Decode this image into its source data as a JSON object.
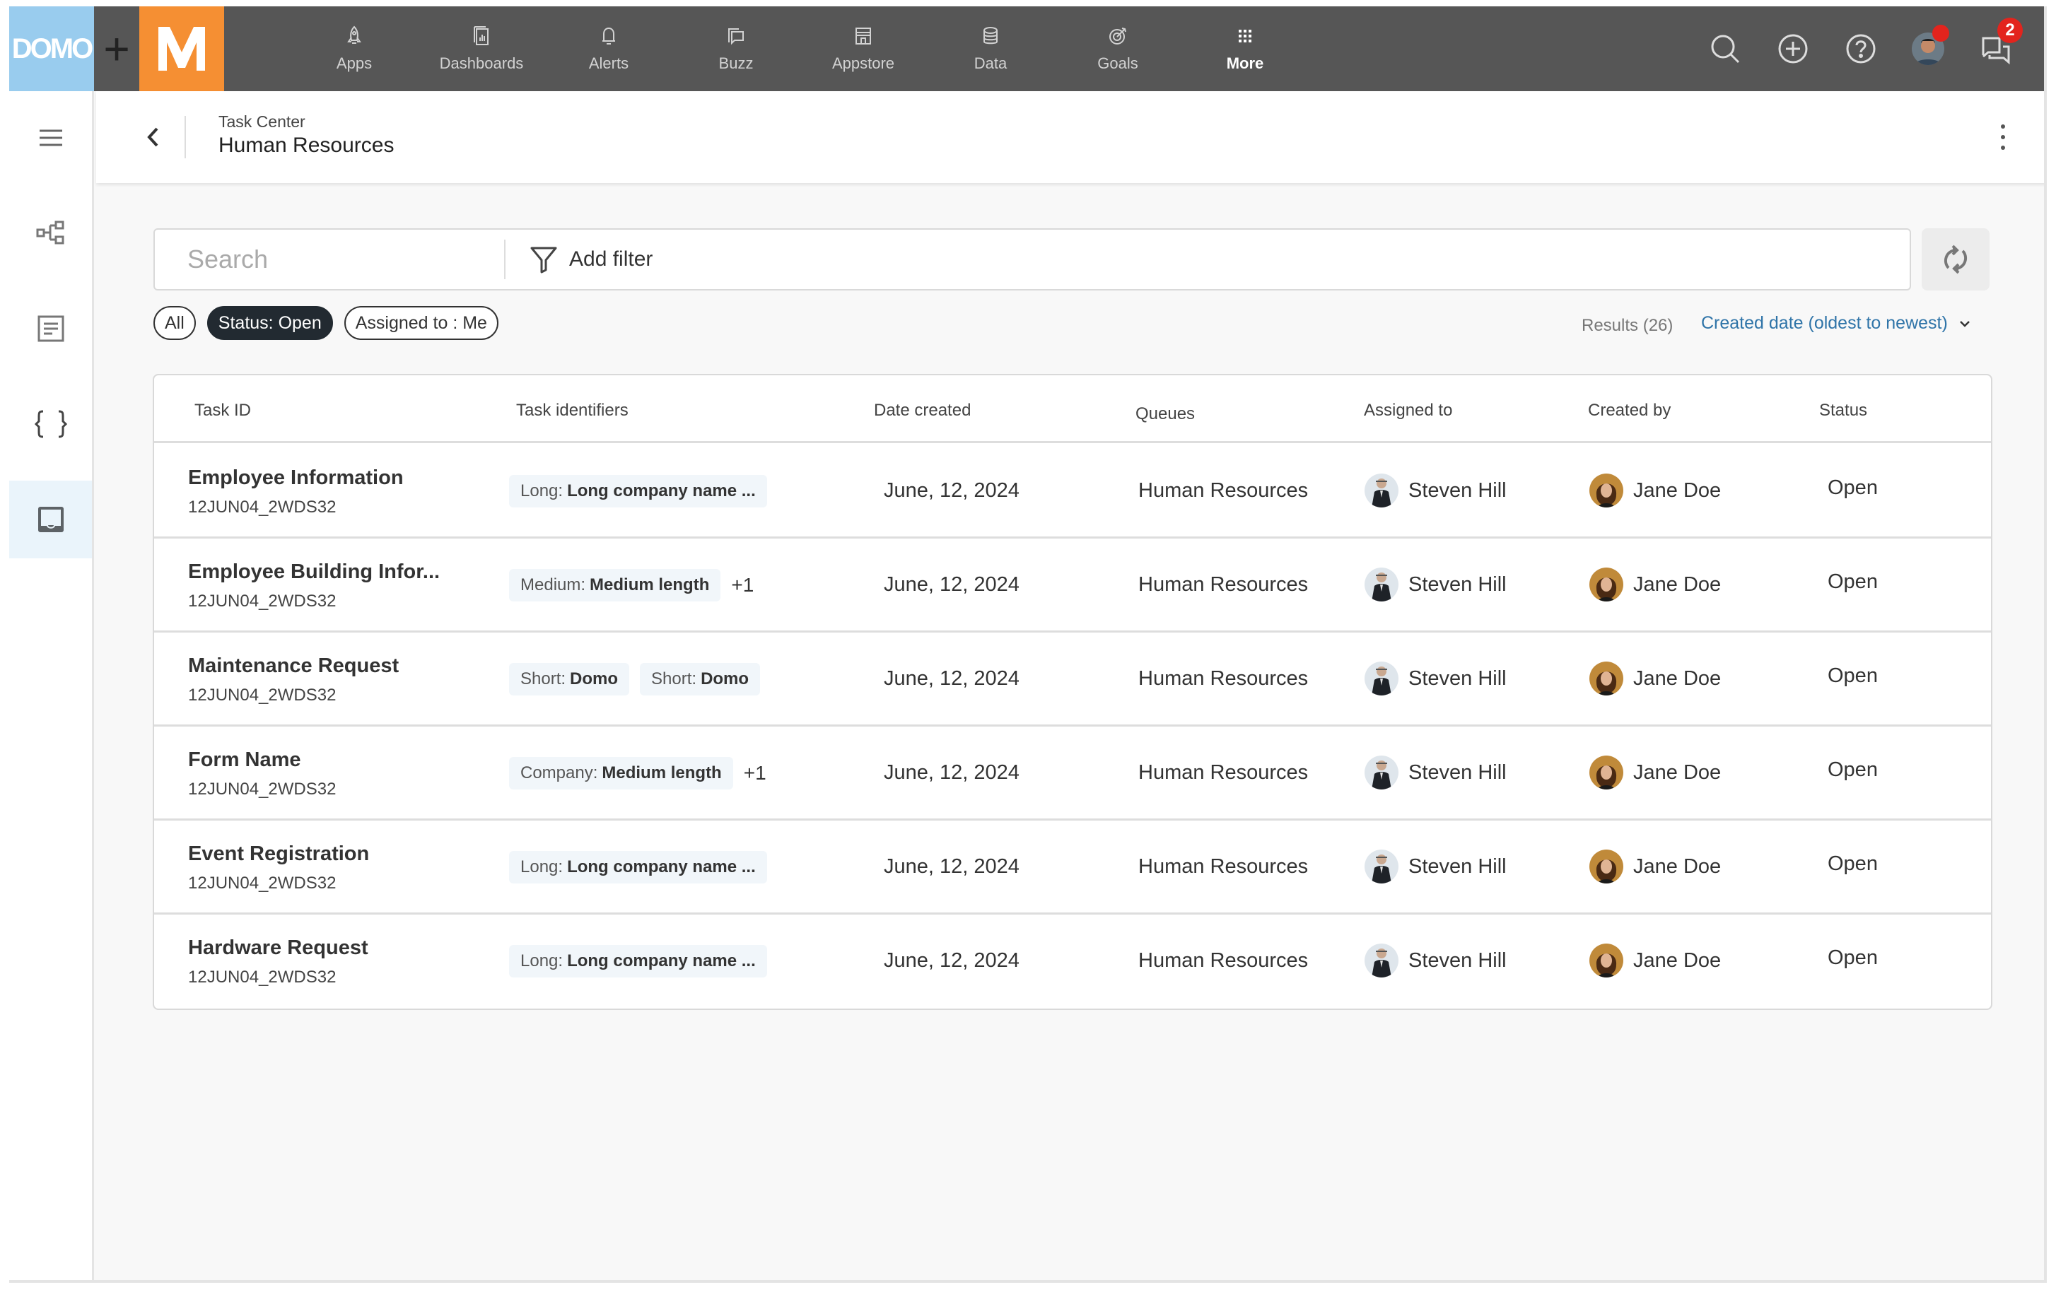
{
  "branding": {
    "domo_logo": "DOMO",
    "plus": "+",
    "m_logo": "M"
  },
  "topnav": {
    "items": [
      {
        "label": "Apps",
        "icon": "rocket-icon"
      },
      {
        "label": "Dashboards",
        "icon": "dashboard-icon"
      },
      {
        "label": "Alerts",
        "icon": "bell-icon"
      },
      {
        "label": "Buzz",
        "icon": "chat-icon"
      },
      {
        "label": "Appstore",
        "icon": "store-icon"
      },
      {
        "label": "Data",
        "icon": "database-icon"
      },
      {
        "label": "Goals",
        "icon": "target-icon"
      },
      {
        "label": "More",
        "icon": "grid-icon",
        "active": true
      }
    ],
    "notifications_count": "2",
    "colors": {
      "bar": "#565656",
      "domo": "#99ccee",
      "m": "#f58f33",
      "badge": "#e3241d"
    }
  },
  "sidebar": {
    "items": [
      {
        "name": "menu",
        "icon": "hamburger-menu-icon"
      },
      {
        "name": "workflows",
        "icon": "workflow-icon"
      },
      {
        "name": "forms",
        "icon": "document-icon"
      },
      {
        "name": "code",
        "icon": "braces-icon"
      },
      {
        "name": "task-center",
        "icon": "inbox-icon",
        "active": true
      }
    ]
  },
  "header": {
    "breadcrumb": "Task Center",
    "title": "Human Resources"
  },
  "search": {
    "placeholder": "Search",
    "value": "",
    "add_filter_label": "Add filter"
  },
  "filters": {
    "chips": [
      {
        "label": "All",
        "active": false
      },
      {
        "label": "Status: Open",
        "active": true
      },
      {
        "label": "Assigned to : Me",
        "active": false
      }
    ],
    "results": "Results (26)",
    "sort_label": "Created date (oldest to newest)"
  },
  "table": {
    "columns": [
      "Task ID",
      "Task identifiers",
      "Date created",
      "Queues",
      "Assigned to",
      "Created by",
      "Status"
    ],
    "rows": [
      {
        "name": "Employee Information",
        "id": "12JUN04_2WDS32",
        "identifiers": [
          {
            "key": "Long:",
            "value": "Long company name ..."
          }
        ],
        "more": "",
        "date": "June, 12, 2024",
        "queue": "Human Resources",
        "assigned": "Steven Hill",
        "creator": "Jane Doe",
        "status": "Open"
      },
      {
        "name": "Employee Building Infor...",
        "id": "12JUN04_2WDS32",
        "identifiers": [
          {
            "key": "Medium:",
            "value": "Medium length"
          }
        ],
        "more": "+1",
        "date": "June, 12, 2024",
        "queue": "Human Resources",
        "assigned": "Steven Hill",
        "creator": "Jane Doe",
        "status": "Open"
      },
      {
        "name": "Maintenance Request",
        "id": "12JUN04_2WDS32",
        "identifiers": [
          {
            "key": "Short:",
            "value": "Domo"
          },
          {
            "key": "Short:",
            "value": "Domo"
          }
        ],
        "more": "",
        "date": "June, 12, 2024",
        "queue": "Human Resources",
        "assigned": "Steven Hill",
        "creator": "Jane Doe",
        "status": "Open"
      },
      {
        "name": "Form Name",
        "id": "12JUN04_2WDS32",
        "identifiers": [
          {
            "key": "Company:",
            "value": "Medium length"
          }
        ],
        "more": "+1",
        "date": "June, 12, 2024",
        "queue": "Human Resources",
        "assigned": "Steven Hill",
        "creator": "Jane Doe",
        "status": "Open"
      },
      {
        "name": "Event Registration",
        "id": "12JUN04_2WDS32",
        "identifiers": [
          {
            "key": "Long:",
            "value": "Long company name ..."
          }
        ],
        "more": "",
        "date": "June, 12, 2024",
        "queue": "Human Resources",
        "assigned": "Steven Hill",
        "creator": "Jane Doe",
        "status": "Open"
      },
      {
        "name": "Hardware Request",
        "id": "12JUN04_2WDS32",
        "identifiers": [
          {
            "key": "Long:",
            "value": "Long company name ..."
          }
        ],
        "more": "",
        "date": "June, 12, 2024",
        "queue": "Human Resources",
        "assigned": "Steven Hill",
        "creator": "Jane Doe",
        "status": "Open"
      }
    ]
  }
}
